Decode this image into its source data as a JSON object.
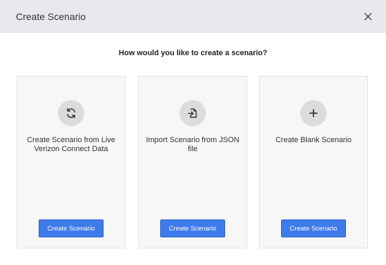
{
  "dialog": {
    "title": "Create Scenario",
    "question": "How would you like to create a scenario?"
  },
  "options": [
    {
      "icon": "refresh-icon",
      "description": "Create Scenario from Live Verizon Connect Data",
      "button_label": "Create Scenario"
    },
    {
      "icon": "file-import-icon",
      "description": "Import Scenario from JSON file",
      "button_label": "Create Scenario"
    },
    {
      "icon": "plus-icon",
      "description": "Create Blank Scenario",
      "button_label": "Create Scenario"
    }
  ],
  "colors": {
    "header_bg": "#e8e9ec",
    "card_bg": "#f7f7f7",
    "button_bg": "#3e7bea",
    "icon_circle": "#dcdcdc"
  }
}
